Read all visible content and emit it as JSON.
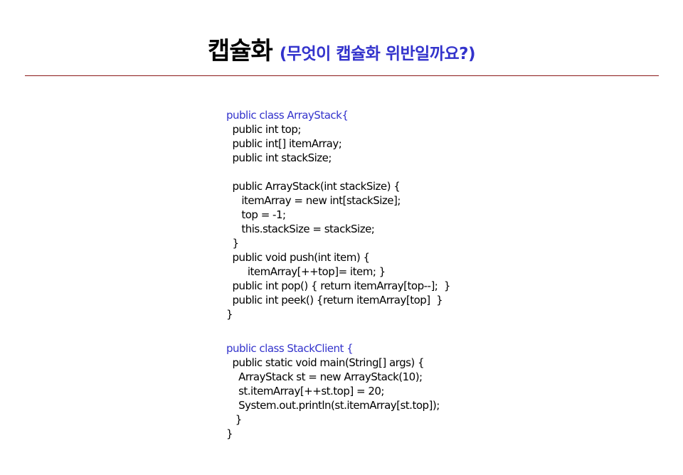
{
  "colors": {
    "accent": "#3333cc",
    "divider": "#8b1a1a",
    "text": "#000000"
  },
  "slide": {
    "title": "캡슐화",
    "subtitle": "(무엇이 캡슐화 위반일까요?)"
  },
  "code_blocks": [
    {
      "lines": [
        {
          "text": "public class ArrayStack{",
          "accent": true
        },
        {
          "text": "  public int top;",
          "accent": false
        },
        {
          "text": "  public int[] itemArray;",
          "accent": false
        },
        {
          "text": "  public int stackSize;",
          "accent": false
        },
        {
          "text": "",
          "accent": false
        },
        {
          "text": "  public ArrayStack(int stackSize) {",
          "accent": false
        },
        {
          "text": "     itemArray = new int[stackSize];",
          "accent": false
        },
        {
          "text": "     top = -1;",
          "accent": false
        },
        {
          "text": "     this.stackSize = stackSize;",
          "accent": false
        },
        {
          "text": "  }",
          "accent": false
        },
        {
          "text": "  public void push(int item) {",
          "accent": false
        },
        {
          "text": "       itemArray[++top]= item; }",
          "accent": false
        },
        {
          "text": "  public int pop() { return itemArray[top--];  }",
          "accent": false
        },
        {
          "text": "  public int peek() {return itemArray[top]  }",
          "accent": false
        },
        {
          "text": "}",
          "accent": false
        }
      ]
    },
    {
      "lines": [
        {
          "text": "public class StackClient {",
          "accent": true
        },
        {
          "text": "  public static void main(String[] args) {",
          "accent": false
        },
        {
          "text": "    ArrayStack st = new ArrayStack(10);",
          "accent": false
        },
        {
          "text": "    st.itemArray[++st.top] = 20;",
          "accent": false
        },
        {
          "text": "    System.out.println(st.itemArray[st.top]);",
          "accent": false
        },
        {
          "text": "   }",
          "accent": false
        },
        {
          "text": "}",
          "accent": false
        }
      ]
    }
  ]
}
